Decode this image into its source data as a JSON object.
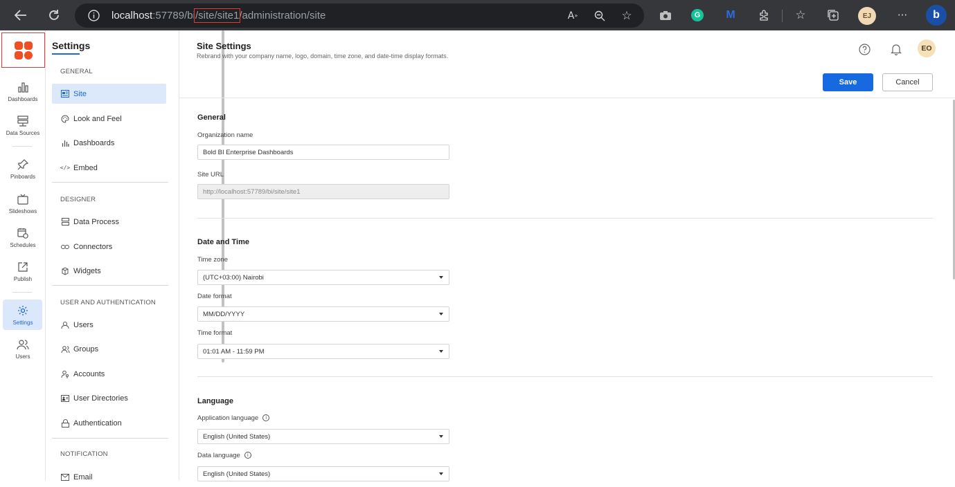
{
  "browser": {
    "url_host": "localhost",
    "url_port_path": ":57789/bi",
    "url_highlight": "/site/site1",
    "url_rest": "/administration/site",
    "profile_initials": "EJ"
  },
  "rail": {
    "items": [
      {
        "label": "Dashboards",
        "icon": "bar-chart-icon"
      },
      {
        "label": "Data Sources",
        "icon": "database-icon"
      },
      {
        "label": "Pinboards",
        "icon": "pin-icon"
      },
      {
        "label": "Slideshows",
        "icon": "tv-icon"
      },
      {
        "label": "Schedules",
        "icon": "calendar-clock-icon"
      },
      {
        "label": "Publish",
        "icon": "share-icon"
      },
      {
        "label": "Settings",
        "icon": "gear-icon"
      },
      {
        "label": "Users",
        "icon": "users-icon"
      }
    ]
  },
  "settings_nav": {
    "title": "Settings",
    "sections": {
      "general": "GENERAL",
      "designer": "DESIGNER",
      "user_auth": "USER AND AUTHENTICATION",
      "notification": "NOTIFICATION"
    },
    "items": {
      "site": "Site",
      "look_and_feel": "Look and Feel",
      "dashboards": "Dashboards",
      "embed": "Embed",
      "data_process": "Data Process",
      "connectors": "Connectors",
      "widgets": "Widgets",
      "users": "Users",
      "groups": "Groups",
      "accounts": "Accounts",
      "user_directories": "User Directories",
      "authentication": "Authentication",
      "email": "Email"
    }
  },
  "header": {
    "title": "Site Settings",
    "subtitle": "Rebrand with your company name, logo, domain, time zone, and date-time display formats.",
    "avatar": "EO",
    "save_label": "Save",
    "cancel_label": "Cancel"
  },
  "general": {
    "title": "General",
    "org_label": "Organization name",
    "org_value": "Bold BI Enterprise Dashboards",
    "site_url_label": "Site URL",
    "site_url_value": "http://localhost:57789/bi/site/site1"
  },
  "datetime": {
    "title": "Date and Time",
    "timezone_label": "Time zone",
    "timezone_value": "(UTC+03:00) Nairobi",
    "date_format_label": "Date format",
    "date_format_value": "MM/DD/YYYY",
    "time_format_label": "Time format",
    "time_format_value": "01:01 AM - 11:59 PM"
  },
  "language": {
    "title": "Language",
    "app_lang_label": "Application language",
    "app_lang_value": "English (United States)",
    "data_lang_label": "Data language",
    "data_lang_value": "English (United States)"
  },
  "colors": {
    "accent": "#1769e0",
    "logo": "#f04e23",
    "highlight_box": "#e53935"
  }
}
